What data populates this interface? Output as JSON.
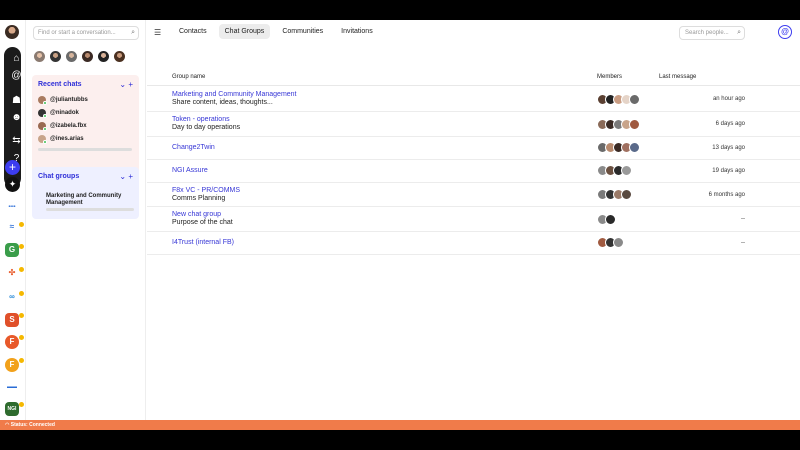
{
  "left_panel": {
    "search_placeholder": "Find or start a conversation...",
    "recent_chats": {
      "title": "Recent chats",
      "items": [
        {
          "handle": "@juliantubbs"
        },
        {
          "handle": "@ninadok"
        },
        {
          "handle": "@izabela.fbx"
        },
        {
          "handle": "@ines.arias"
        }
      ]
    },
    "chat_groups": {
      "title": "Chat groups",
      "items": [
        "Marketing and Community Management"
      ]
    }
  },
  "main": {
    "tabs": [
      "Contacts",
      "Chat Groups",
      "Communities",
      "Invitations"
    ],
    "active_tab": "Chat Groups",
    "search_placeholder": "Search people...",
    "columns": {
      "group_name": "Group name",
      "members": "Members",
      "last_message": "Last message"
    },
    "rows": [
      {
        "name": "Marketing and Community Management",
        "desc": "Share content, ideas, thoughts...",
        "last": "an hour ago"
      },
      {
        "name": "Token - operations",
        "desc": "Day to day operations",
        "last": "6 days ago"
      },
      {
        "name": "Change2Twin",
        "desc": "",
        "last": "13 days ago"
      },
      {
        "name": "NGI Assure",
        "desc": "",
        "last": "19 days ago"
      },
      {
        "name": "F8x VC - PR/COMMS",
        "desc": "Comms Planning",
        "last": "6 months ago"
      },
      {
        "name": "New chat group",
        "desc": "Purpose of the chat",
        "last": "--"
      },
      {
        "name": "I4Trust (internal FB)",
        "desc": "",
        "last": "--"
      }
    ]
  },
  "status": {
    "text": "Status: Connected"
  },
  "colors": {
    "accent": "#3d3df0",
    "status_bar": "#f07b4a"
  },
  "icons": [
    "home-icon",
    "at-icon",
    "contacts-icon",
    "bot-icon",
    "transfer-icon",
    "help-icon",
    "plus-icon",
    "compass-icon"
  ]
}
